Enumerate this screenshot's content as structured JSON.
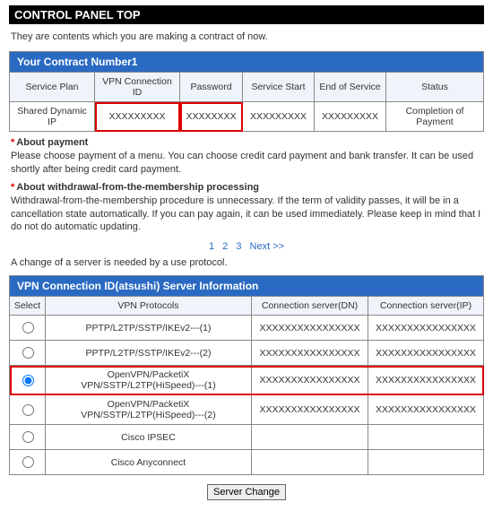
{
  "page_title": "CONTROL PANEL TOP",
  "intro_text": "They are contents which you are making a contract of now.",
  "contract": {
    "section_title": "Your Contract Number1",
    "headers": {
      "plan": "Service Plan",
      "vpn_id": "VPN Connection ID",
      "password": "Password",
      "service_start": "Service Start",
      "end_of_service": "End of Service",
      "status": "Status"
    },
    "row": {
      "plan": "Shared Dynamic IP",
      "vpn_id": "XXXXXXXXX",
      "password": "XXXXXXXX",
      "service_start": "XXXXXXXXX",
      "end_of_service": "XXXXXXXXX",
      "status": "Completion of Payment"
    }
  },
  "notes": {
    "payment_head": "About payment",
    "payment_body": "Please choose payment of a menu. You can choose credit card payment and bank transfer. It can be used shortly after being credit card payment.",
    "withdraw_head": "About withdrawal-from-the-membership processing",
    "withdraw_body": "Withdrawal-from-the-membership procedure is unnecessary. If the term of validity passes, it will be in a cancellation state automatically. If you can pay again, it can be used immediately. Please keep in mind that I do not do automatic updating."
  },
  "pager": {
    "p1": "1",
    "p2": "2",
    "p3": "3",
    "next": "Next >>"
  },
  "change_note": "A change of a server is needed by a use protocol.",
  "server": {
    "section_title": "VPN Connection ID(atsushi) Server Information",
    "headers": {
      "select": "Select",
      "protocols": "VPN Protocols",
      "conn_dn": "Connection server(DN)",
      "conn_ip": "Connection server(IP)"
    },
    "rows": [
      {
        "protocol": "PPTP/L2TP/SSTP/IKEv2---(1)",
        "dn": "XXXXXXXXXXXXXXXX",
        "ip": "XXXXXXXXXXXXXXXX"
      },
      {
        "protocol": "PPTP/L2TP/SSTP/IKEv2---(2)",
        "dn": "XXXXXXXXXXXXXXXX",
        "ip": "XXXXXXXXXXXXXXXX"
      },
      {
        "protocol": "OpenVPN/PacketiX VPN/SSTP/L2TP(HiSpeed)---(1)",
        "dn": "XXXXXXXXXXXXXXXX",
        "ip": "XXXXXXXXXXXXXXXX"
      },
      {
        "protocol": "OpenVPN/PacketiX VPN/SSTP/L2TP(HiSpeed)---(2)",
        "dn": "XXXXXXXXXXXXXXXX",
        "ip": "XXXXXXXXXXXXXXXX"
      },
      {
        "protocol": "Cisco IPSEC",
        "dn": "",
        "ip": ""
      },
      {
        "protocol": "Cisco Anyconnect",
        "dn": "",
        "ip": ""
      }
    ],
    "selected_index": 2
  },
  "button_label": "Server Change"
}
